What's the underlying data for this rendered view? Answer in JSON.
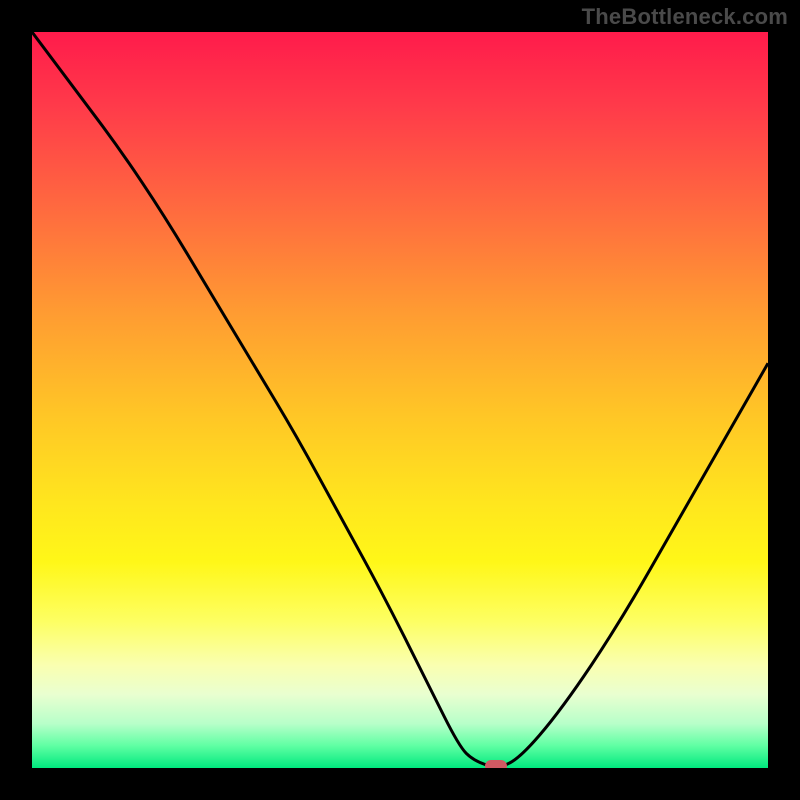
{
  "watermark": "TheBottleneck.com",
  "colors": {
    "frame_background": "#000000",
    "curve_stroke": "#000000",
    "marker_fill": "#cf5a63",
    "watermark_text": "#4a4a4a",
    "gradient_stops": [
      "#ff1b4b",
      "#ff3a4a",
      "#ff6a3f",
      "#ff9b32",
      "#ffc626",
      "#ffe61e",
      "#fff718",
      "#fdff62",
      "#faffb0",
      "#e9ffd0",
      "#b7ffc9",
      "#5fffa3",
      "#00e97e"
    ]
  },
  "chart_data": {
    "type": "line",
    "title": "",
    "xlabel": "",
    "ylabel": "",
    "xlim": [
      0,
      100
    ],
    "ylim": [
      0,
      100
    ],
    "grid": false,
    "legend": false,
    "series": [
      {
        "name": "bottleneck-curve",
        "x": [
          0,
          6,
          12,
          18,
          24,
          30,
          36,
          42,
          48,
          54,
          58,
          60,
          63,
          66,
          72,
          80,
          88,
          96,
          100
        ],
        "y": [
          100,
          92,
          84,
          75,
          65,
          55,
          45,
          34,
          23,
          11,
          3,
          1,
          0,
          1,
          8,
          20,
          34,
          48,
          55
        ]
      }
    ],
    "marker": {
      "x": 63,
      "y": 0
    },
    "note": "x and y are percentages of the plot area; higher y is shown higher (SVG is flipped)."
  }
}
